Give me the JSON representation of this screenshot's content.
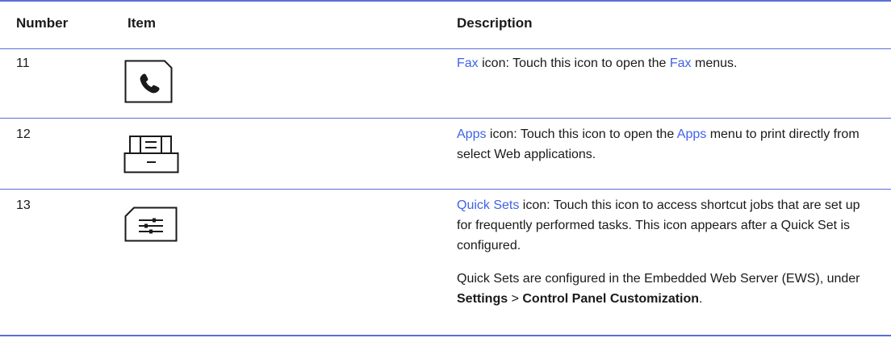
{
  "header": {
    "number": "Number",
    "item": "Item",
    "description": "Description"
  },
  "rows": [
    {
      "number": "11",
      "icon": "phone-icon",
      "link1": "Fax",
      "text1": " icon: Touch this icon to open the ",
      "link2": "Fax",
      "text2": " menus."
    },
    {
      "number": "12",
      "icon": "apps-tray-icon",
      "link1": "Apps",
      "text1": " icon: Touch this icon to open the ",
      "link2": "Apps",
      "text2": " menu to print directly from select Web applications."
    },
    {
      "number": "13",
      "icon": "quick-sets-icon",
      "link1": "Quick Sets",
      "text1": " icon: Touch this icon to access shortcut jobs that are set up for frequently performed tasks. This icon appears after a Quick Set is configured.",
      "p2_text1": "Quick Sets are configured in the Embedded Web Server (EWS), under ",
      "p2_bold1": "Settings",
      "p2_sep": " > ",
      "p2_bold2": "Control Panel Customization",
      "p2_end": "."
    }
  ],
  "colors": {
    "rule": "#5a6fd8",
    "link": "#3f63e8"
  }
}
